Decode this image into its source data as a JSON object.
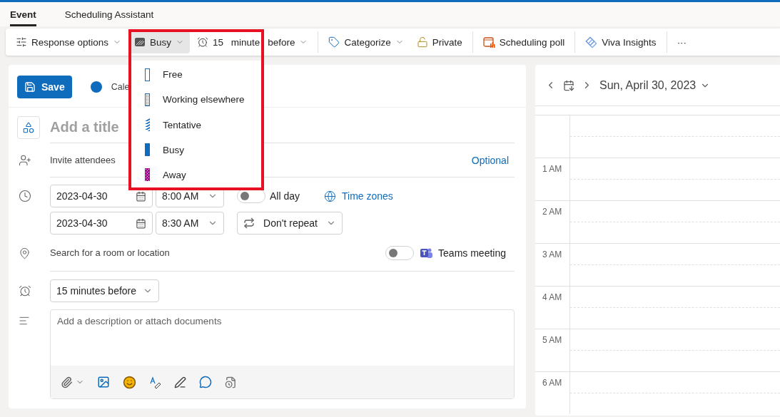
{
  "tabs": [
    {
      "label": "Event",
      "selected": true
    },
    {
      "label": "Scheduling Assistant",
      "selected": false
    }
  ],
  "toolbar": [
    {
      "kind": "response",
      "label": "Response options",
      "caret": true
    },
    {
      "kind": "status",
      "label": "Busy",
      "caret": true,
      "selected": true
    },
    {
      "kind": "reminder",
      "label": "15 minute before",
      "caret": true,
      "selected": false
    },
    {
      "kind": "separator"
    },
    {
      "kind": "categorize",
      "label": "Categorize",
      "caret": true,
      "selected": false
    },
    {
      "kind": "private",
      "label": "Private",
      "caret": false,
      "selected": false
    },
    {
      "kind": "separator"
    },
    {
      "kind": "poll",
      "label": "Scheduling poll",
      "caret": false,
      "selected": false
    },
    {
      "kind": "separator"
    },
    {
      "kind": "viva",
      "label": "Viva Insights",
      "caret": false,
      "selected": false
    },
    {
      "kind": "separator"
    },
    {
      "kind": "more",
      "label": "···",
      "caret": false,
      "selected": false
    }
  ],
  "status_menu": [
    {
      "label": "Free",
      "kind": "outline",
      "color": "#0f6cbd"
    },
    {
      "label": "Working elsewhere",
      "kind": "dotted",
      "color": "#0f6cbd"
    },
    {
      "label": "Tentative",
      "kind": "striped",
      "color": "#0f6cbd"
    },
    {
      "label": "Busy",
      "kind": "solid",
      "color": "#0f6cbd"
    },
    {
      "label": "Away",
      "kind": "checkered",
      "color": "#b4009e"
    }
  ],
  "form": {
    "save": "Save",
    "calendar": "Cale",
    "title_placeholder": "Add a title",
    "attendees_placeholder": "Invite attendees",
    "optional": "Optional",
    "start_date": "2023-04-30",
    "start_time": "8:00 AM",
    "all_day": {
      "label": "All day",
      "on": false
    },
    "time_zones": "Time zones",
    "end_date": "2023-04-30",
    "end_time": "8:30 AM",
    "repeat": "Don't repeat",
    "location_placeholder": "Search for a room or location",
    "teams": {
      "label": "Teams meeting",
      "on": false
    },
    "reminder": "15 minutes before",
    "description_placeholder": "Add a description or attach documents"
  },
  "day_view": {
    "date": "Sun, April 30, 2023",
    "hours": [
      "1 AM",
      "2 AM",
      "3 AM",
      "4 AM",
      "5 AM",
      "6 AM"
    ]
  }
}
